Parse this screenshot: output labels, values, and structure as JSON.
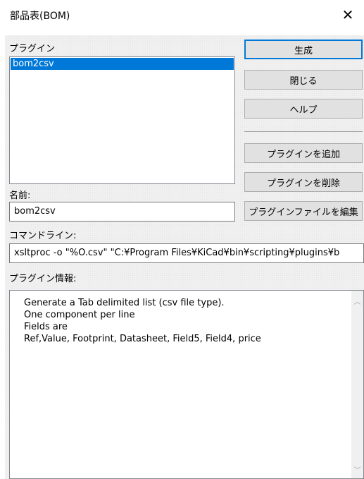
{
  "window": {
    "title": "部品表(BOM)"
  },
  "plugins": {
    "label": "プラグイン",
    "items": [
      "bom2csv"
    ]
  },
  "name": {
    "label": "名前:",
    "value": "bom2csv"
  },
  "command": {
    "label": "コマンドライン:",
    "value": "xsltproc -o \"%O.csv\" \"C:¥Program Files¥KiCad¥bin¥scripting¥plugins¥b"
  },
  "info": {
    "label": "プラグイン情報:",
    "lines": [
      "Generate a Tab delimited list (csv file type).",
      "One component per line",
      "Fields are",
      "Ref,Value, Footprint, Datasheet, Field5, Field4, price"
    ]
  },
  "buttons": {
    "generate": "生成",
    "close": "閉じる",
    "help": "ヘルプ",
    "add_plugin": "プラグインを追加",
    "remove_plugin": "プラグインを削除",
    "edit_plugin_file": "プラグインファイルを編集"
  },
  "icons": {
    "close": "close-icon",
    "scroll_up": "chevron-up-icon",
    "scroll_down": "chevron-down-icon"
  },
  "colors": {
    "selection": "#0078d7",
    "dialog_bg": "#f0f0f0"
  }
}
